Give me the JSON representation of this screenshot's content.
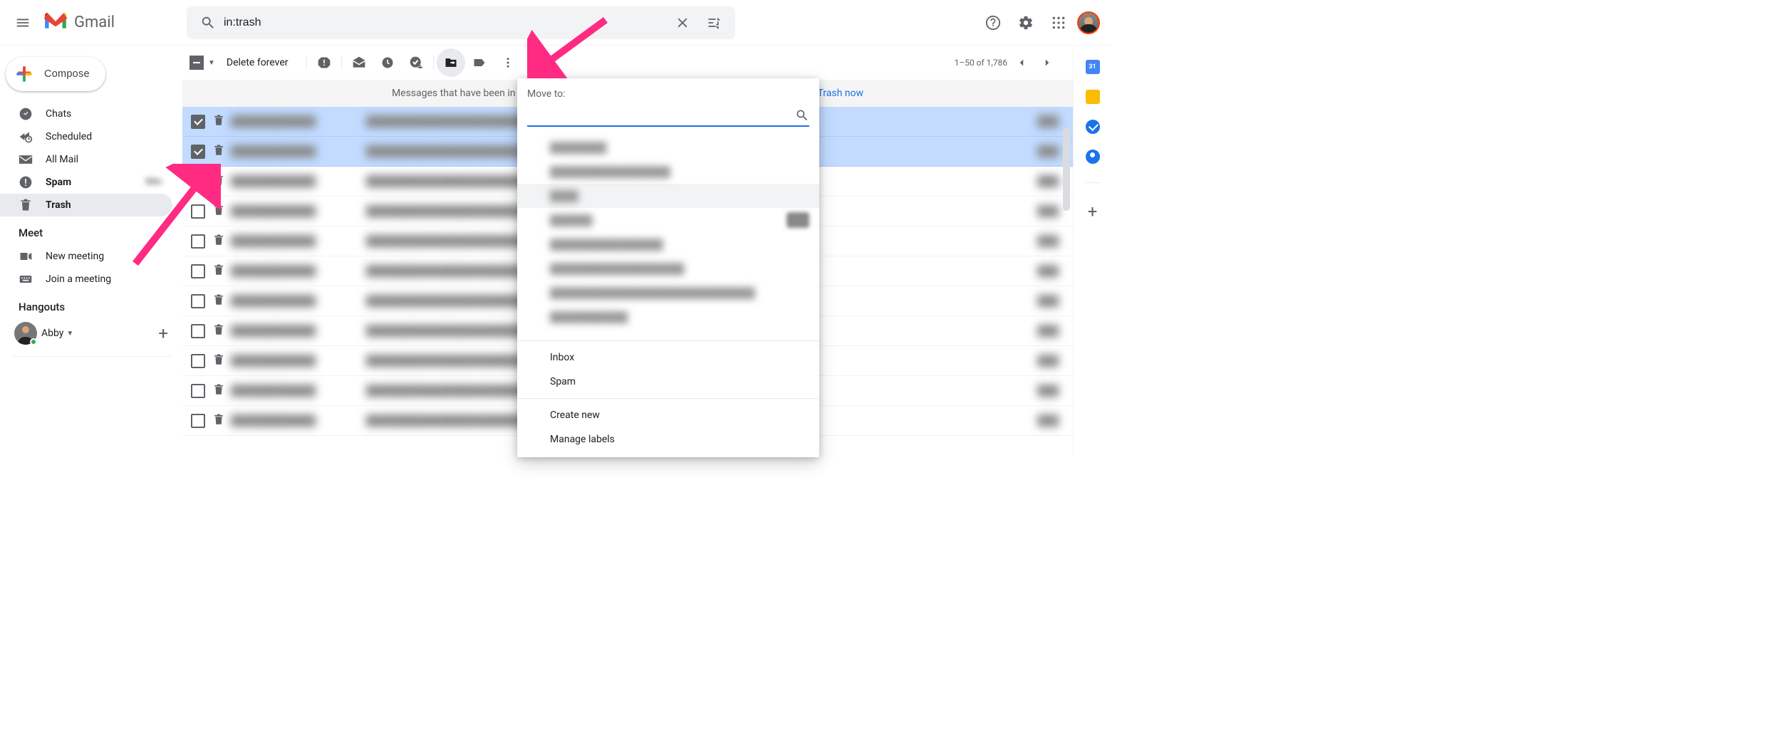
{
  "header": {
    "app_name": "Gmail",
    "search_value": "in:trash"
  },
  "compose_label": "Compose",
  "sidebar": {
    "items": [
      {
        "label": "Chats"
      },
      {
        "label": "Scheduled"
      },
      {
        "label": "All Mail"
      },
      {
        "label": "Spam"
      },
      {
        "label": "Trash"
      }
    ],
    "meet_title": "Meet",
    "meet_items": [
      {
        "label": "New meeting"
      },
      {
        "label": "Join a meeting"
      }
    ],
    "hangouts_title": "Hangouts",
    "hangouts_user": "Abby"
  },
  "toolbar": {
    "delete_forever": "Delete forever",
    "pager": "1–50 of 1,786"
  },
  "banner": {
    "text_prefix": "Messages that have been in",
    "link": "Trash now"
  },
  "popup": {
    "title": "Move to:",
    "inbox": "Inbox",
    "spam": "Spam",
    "create": "Create new",
    "manage": "Manage labels"
  },
  "colors": {
    "blue": "#1a73e8",
    "selection": "#c2dbff",
    "arrow": "#ff2b83"
  },
  "spam_count": "99+"
}
